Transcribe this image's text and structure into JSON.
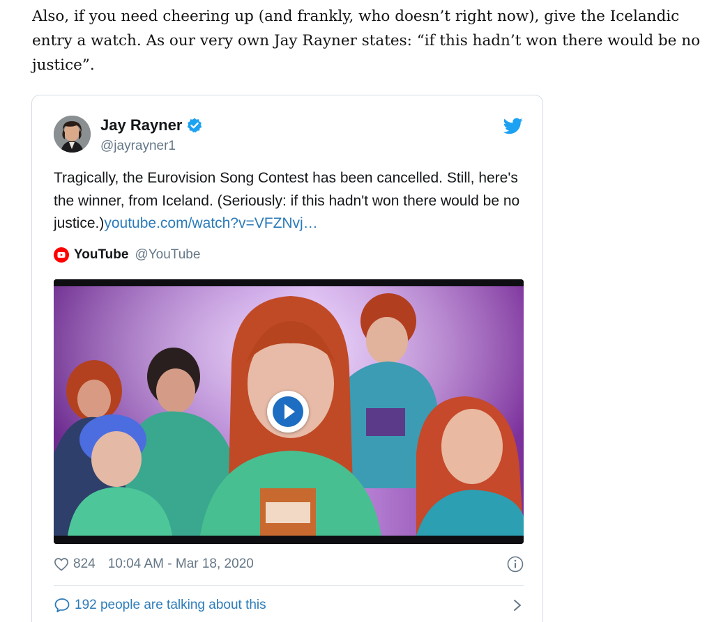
{
  "article": {
    "paragraph": "Also, if you need cheering up (and frankly, who doesn’t right now), give the Icelandic entry a watch. As our very own Jay Rayner states: “if this hadn’t won there would be no justice”."
  },
  "tweet": {
    "author_name": "Jay Rayner",
    "author_handle": "@jayrayner1",
    "text": "Tragically, the Eurovision Song Contest has been cancelled. Still, here's the winner, from Iceland. (Seriously: if this hadn't won there would be no justice.)",
    "link_text": "youtube.com/watch?v=VFZNvj…",
    "quote": {
      "source_name": "YouTube",
      "source_handle": "@YouTube"
    },
    "likes": "824",
    "timestamp": "10:04 AM - Mar 18, 2020",
    "talking": "192 people are talking about this"
  },
  "icons": {
    "verified": "verified-badge-icon",
    "brand": "twitter-bird-icon",
    "youtube": "youtube-logo-icon",
    "play": "play-icon",
    "like": "heart-icon",
    "info": "info-icon",
    "replies": "speech-bubble-icon",
    "more": "chevron-right-icon"
  },
  "colors": {
    "twitter_blue": "#1da1f2",
    "link": "#2b7bb9",
    "muted": "#657786",
    "youtube_red": "#ff0000"
  }
}
